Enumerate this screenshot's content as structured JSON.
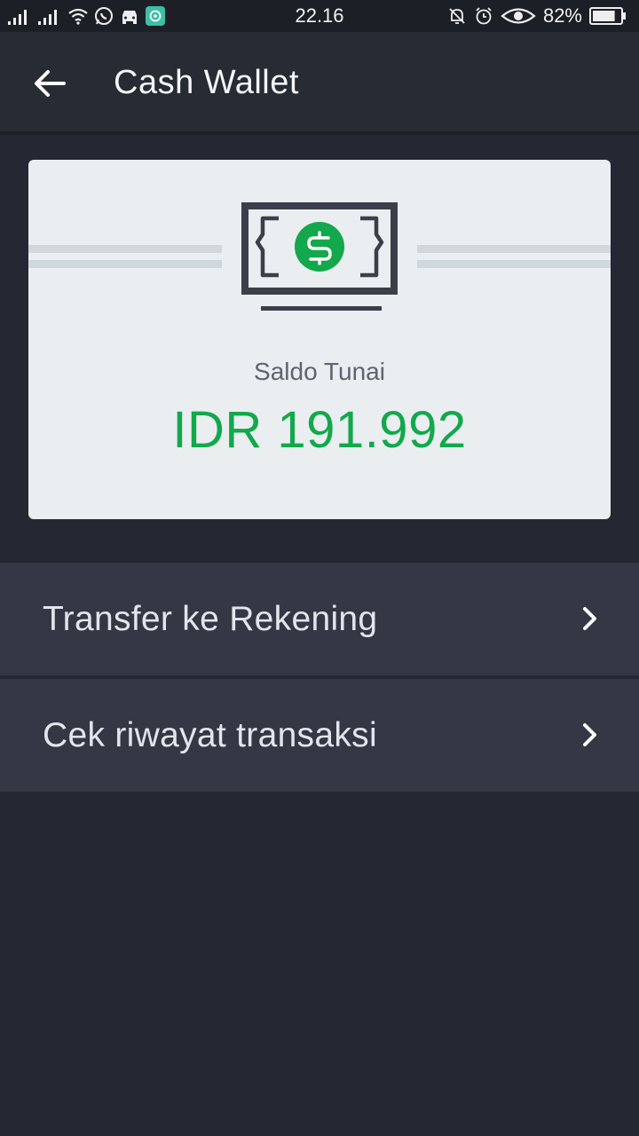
{
  "status_bar": {
    "time": "22.16",
    "battery_percent": "82%",
    "icons": [
      "signal-icon",
      "signal-icon",
      "wifi-icon",
      "whatsapp-icon",
      "car-icon",
      "app-badge-icon",
      "bell-muted-icon",
      "alarm-icon",
      "eye-icon",
      "battery-icon"
    ],
    "battery_level": 0.82
  },
  "header": {
    "title": "Cash Wallet",
    "back_icon": "arrow-left-icon"
  },
  "balance": {
    "label": "Saldo Tunai",
    "amount": "IDR 191.992",
    "icon": "cash-bill-icon",
    "accent_color": "#13a84b"
  },
  "menu": {
    "items": [
      {
        "label": "Transfer ke Rekening",
        "icon": "chevron-right-icon"
      },
      {
        "label": "Cek riwayat transaksi",
        "icon": "chevron-right-icon"
      }
    ]
  },
  "colors": {
    "background": "#252832",
    "card": "#eaeef1",
    "menu_item": "#343844"
  }
}
